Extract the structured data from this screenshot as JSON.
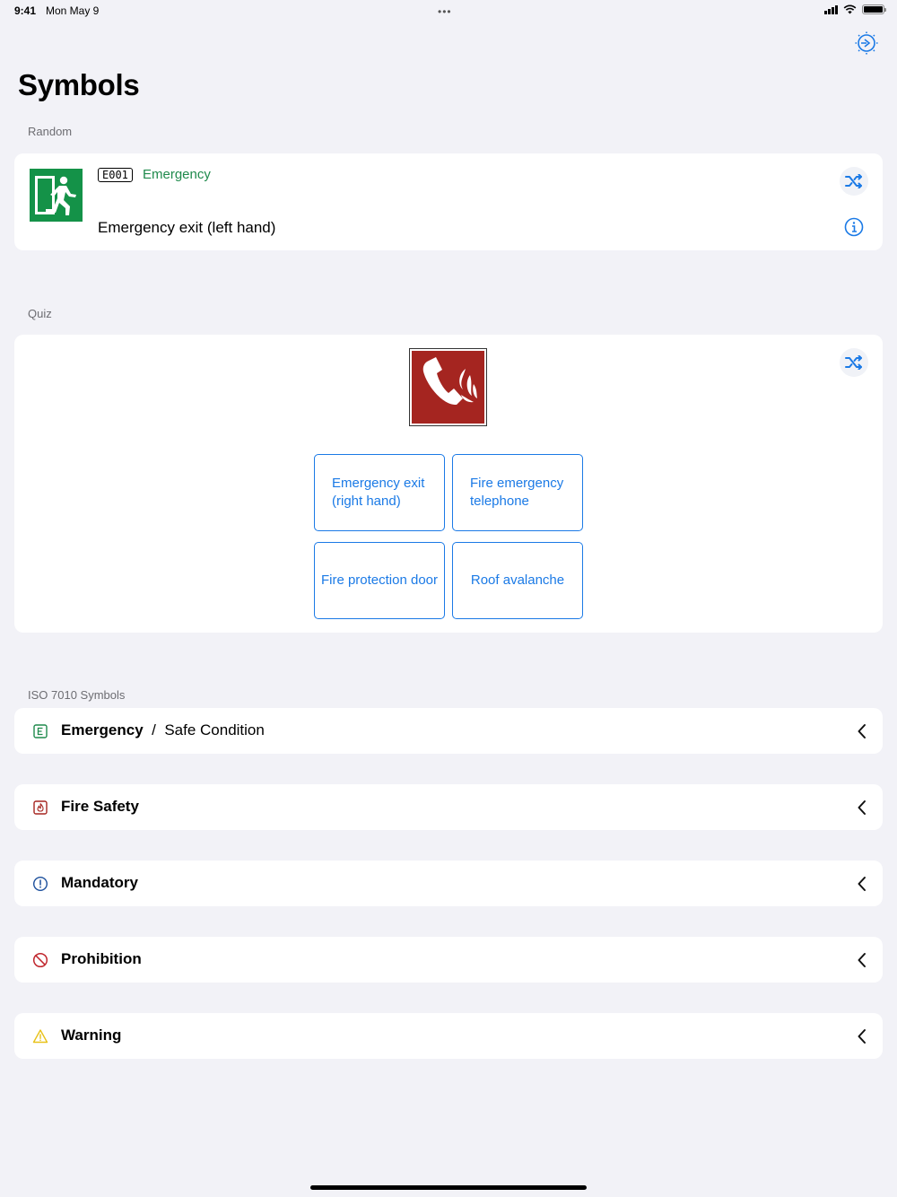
{
  "status": {
    "time": "9:41",
    "date": "Mon May 9",
    "dots": "•••"
  },
  "header": {
    "title": "Symbols",
    "settings_icon": "settings-gear-icon"
  },
  "random": {
    "section_label": "Random",
    "code": "E001",
    "category": "Emergency",
    "name": "Emergency exit (left hand)",
    "shuffle_icon": "shuffle-icon",
    "info_icon": "info-icon"
  },
  "quiz": {
    "section_label": "Quiz",
    "shuffle_icon": "shuffle-icon",
    "answers": [
      "Emergency exit (right hand)",
      "Fire emergency telephone",
      "Fire protection door",
      "Roof avalanche"
    ]
  },
  "iso": {
    "section_label": "ISO 7010 Symbols",
    "categories": [
      {
        "title": "Emergency",
        "sep": "/",
        "subtitle": "Safe Condition",
        "icon": "emergency-e-icon"
      },
      {
        "title": "Fire Safety",
        "icon": "fire-safety-icon"
      },
      {
        "title": "Mandatory",
        "icon": "mandatory-icon"
      },
      {
        "title": "Prohibition",
        "icon": "prohibition-icon"
      },
      {
        "title": "Warning",
        "icon": "warning-icon"
      }
    ]
  },
  "colors": {
    "accent": "#1b7ae6",
    "emergency_green": "#1f8a4c",
    "fire_red": "#a52520",
    "warning_yellow": "#e8c21a",
    "background": "#f2f2f7"
  }
}
